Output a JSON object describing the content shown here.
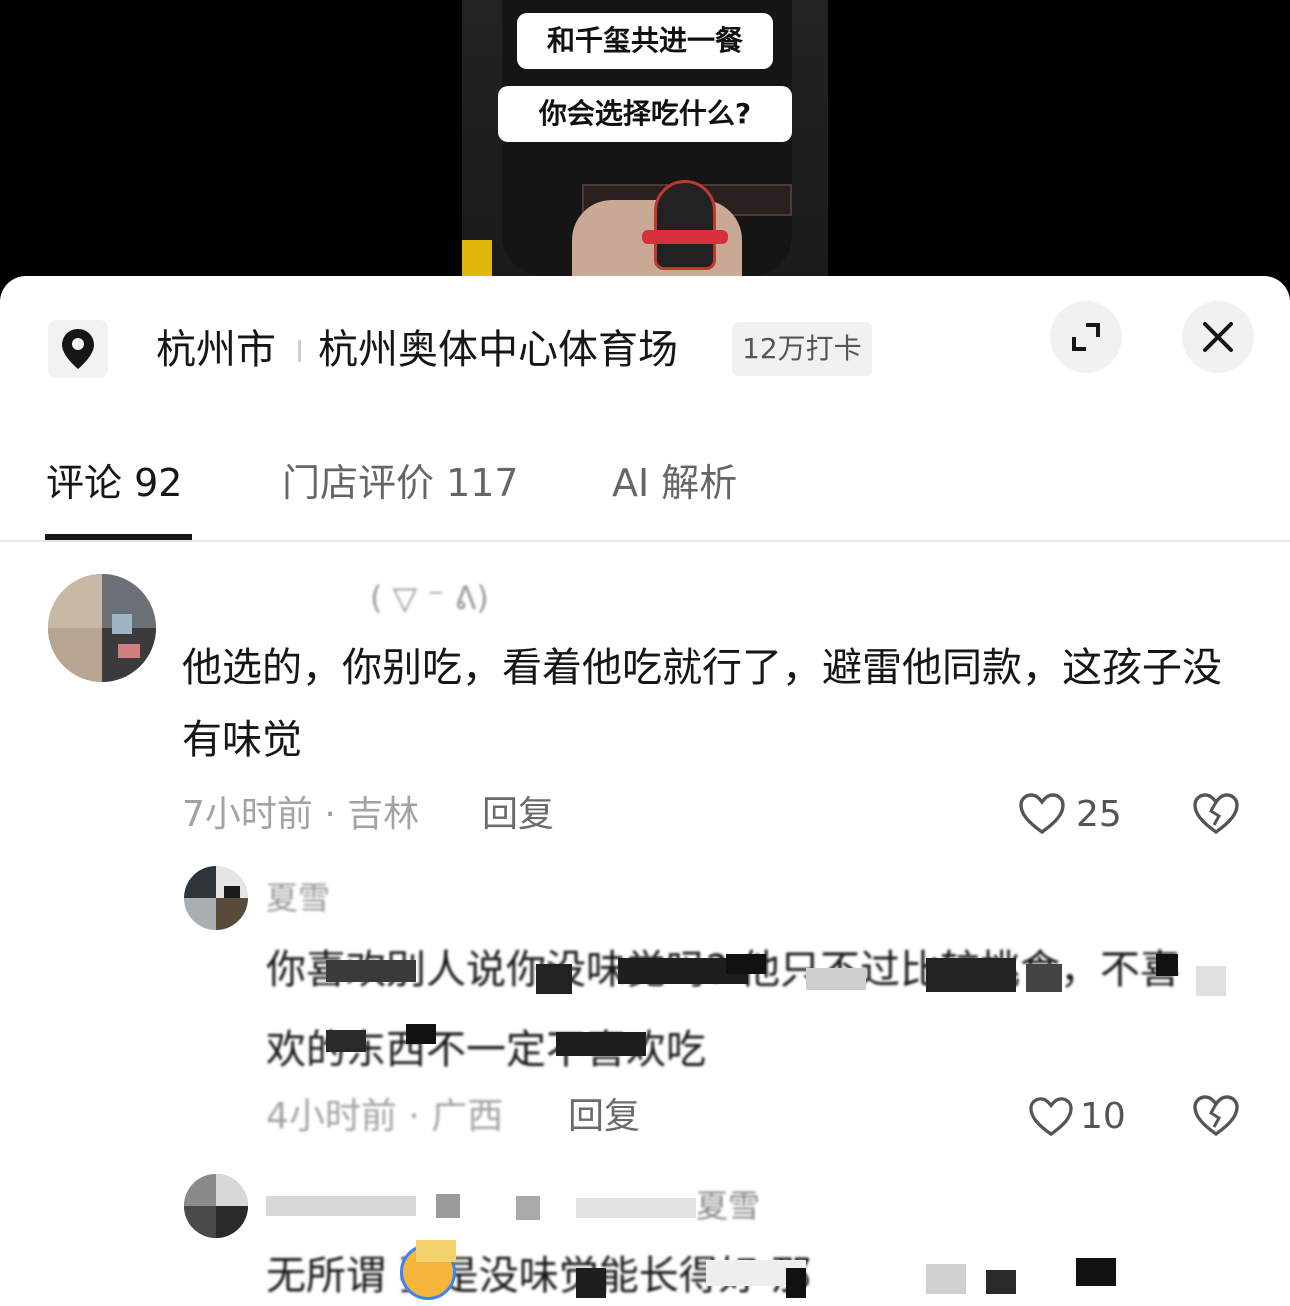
{
  "video": {
    "caption_1": "和千玺共进一餐",
    "caption_2": "你会选择吃什么?"
  },
  "location": {
    "city": "杭州市",
    "venue": "杭州奥体中心体育场",
    "checkins": "12万打卡"
  },
  "tabs": [
    {
      "label": "评论 92",
      "active": true
    },
    {
      "label": "门店评价 117",
      "active": false
    },
    {
      "label": "AI 解析",
      "active": false
    }
  ],
  "comments": [
    {
      "username": "(  ▽ ⁻ ᕕ)",
      "text": "他选的，你别吃，看着他吃就行了，避雷他同款，这孩子没有味觉",
      "time_location": "7小时前 · 吉林",
      "reply_label": "回复",
      "likes": "25"
    },
    {
      "username": "夏雪",
      "text_line_1": "你喜欢别人说你没味觉吗? 他只不过比较挑食，不喜",
      "text_line_2": "欢的东西不一定不喜欢吃",
      "time_location": "4小时前 · 广西",
      "reply_label": "回复",
      "likes": "10"
    },
    {
      "username": "夏雪",
      "text": "无所谓 要是没味觉能长得好 那"
    }
  ],
  "colors": {
    "text_primary": "#161616",
    "text_secondary": "#a3a3a3",
    "sheet_background": "#ffffff",
    "chip_background": "#f1f1f1"
  },
  "icons": [
    "location-pin-icon",
    "expand-icon",
    "close-icon",
    "heart-icon",
    "broken-heart-icon",
    "emoji-icon"
  ]
}
